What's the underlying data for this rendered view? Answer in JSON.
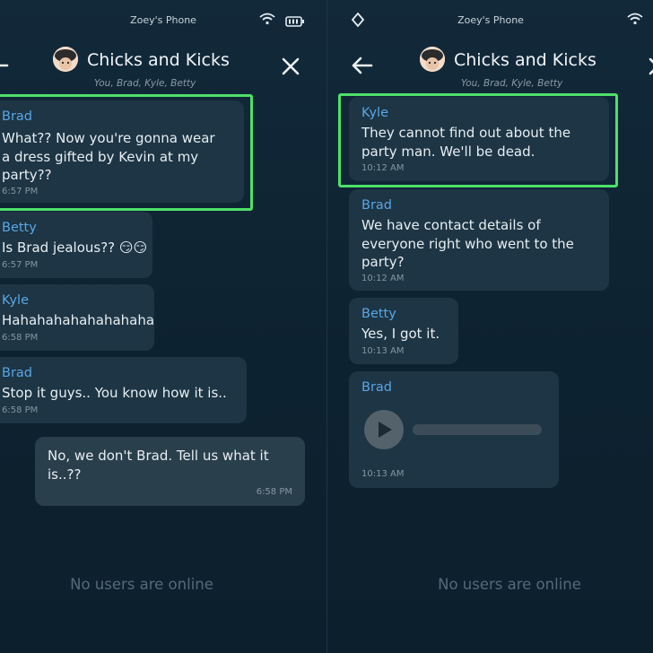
{
  "device_title": "Zoey's Phone",
  "chat": {
    "title": "Chicks and Kicks",
    "members": "You, Brad, Kyle, Betty"
  },
  "left": {
    "messages": [
      {
        "sender": "Brad",
        "text": "What?? Now you're gonna wear\na dress gifted by Kevin at my\nparty??",
        "time": "6:57 PM"
      },
      {
        "sender": "Betty",
        "text": "Is Brad jealous?? 😏😏",
        "time": "6:57 PM"
      },
      {
        "sender": "Kyle",
        "text": "Hahahahahahahahaha",
        "time": "6:58 PM"
      },
      {
        "sender": "Brad",
        "text": "Stop it guys.. You know how it is..",
        "time": "6:58 PM"
      },
      {
        "text": "No, we don't Brad. Tell us what it\nis..??",
        "time": "6:58 PM"
      }
    ],
    "footer": "No users are online"
  },
  "right": {
    "messages": [
      {
        "sender": "Kyle",
        "text": "They cannot find out about the\nparty man. We'll be dead.",
        "time": "10:12 AM"
      },
      {
        "sender": "Brad",
        "text": "We have contact details of\neveryone right who went to the\nparty?",
        "time": "10:12 AM"
      },
      {
        "sender": "Betty",
        "text": "Yes, I got it.",
        "time": "10:13 AM"
      },
      {
        "sender": "Brad",
        "time": "10:13 AM"
      }
    ],
    "footer": "No users are online"
  },
  "icons": {
    "wifi": "wifi-icon",
    "battery": "battery-icon",
    "back": "arrow-left-icon",
    "close": "close-icon",
    "settings": "diamond-icon",
    "play": "play-icon"
  },
  "colors": {
    "highlight": "#4ee06a",
    "sender": "#5aa6e6",
    "background": "#0f2431",
    "bubble": "#1d3544"
  }
}
